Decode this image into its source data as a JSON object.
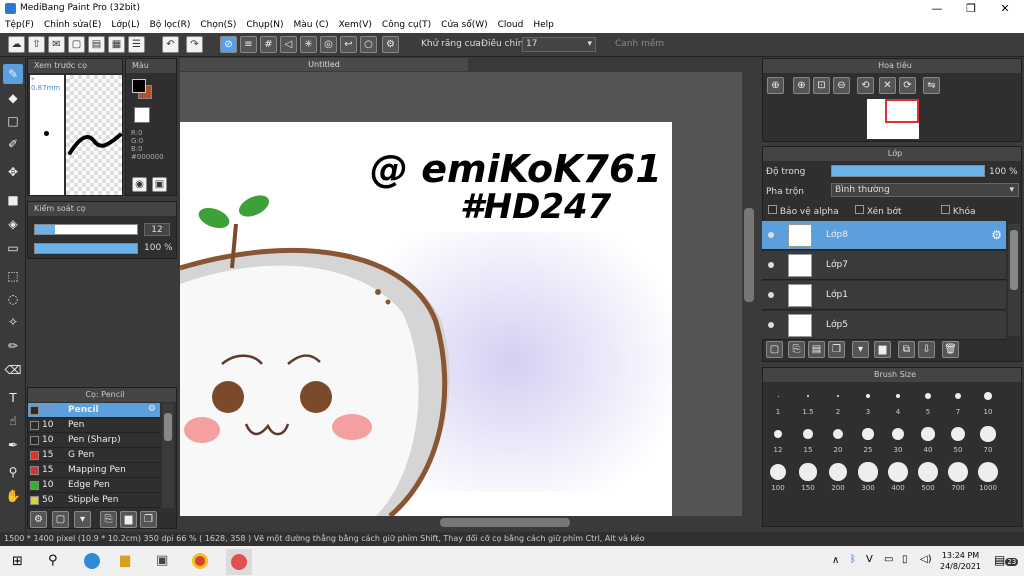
{
  "window": {
    "title": "MediBang Paint Pro (32bit)",
    "minimize": "—",
    "maximize": "❐",
    "close": "✕"
  },
  "menu": [
    "Tệp(F)",
    "Chỉnh sửa(E)",
    "Lớp(L)",
    "Bộ lọc(R)",
    "Chọn(S)",
    "Chụp(N)",
    "Màu (C)",
    "Xem(V)",
    "Công cụ(T)",
    "Cửa sổ(W)",
    "Cloud",
    "Help"
  ],
  "toolbar": {
    "antialias_label": "Khử răng cưa",
    "adjust_label": "Điều chỉnh",
    "adjust_value": "17",
    "snap_label": "Canh mềm"
  },
  "preview_panel": {
    "title": "Xem trước cọ",
    "size_label": "* 0.87mm"
  },
  "color_panel": {
    "title": "Màu",
    "r": "R:0",
    "g": "G:0",
    "b": "B:0",
    "hex": "#000000",
    "fg_color": "#000000",
    "bg_color": "#b05030"
  },
  "brush_control": {
    "title": "Kiểm soát cọ",
    "size_value": "12",
    "opacity_value": "100 %",
    "size_fraction": 0.2,
    "opacity_fraction": 1.0
  },
  "brush_list": {
    "title": "Cọ: Pencil",
    "items": [
      {
        "size": "12",
        "name": "Pencil",
        "color": "#2a2a2a",
        "selected": true
      },
      {
        "size": "10",
        "name": "Pen",
        "color": "#2a2a2a"
      },
      {
        "size": "10",
        "name": "Pen (Sharp)",
        "color": "#2a2a2a"
      },
      {
        "size": "15",
        "name": "G Pen",
        "color": "#e03030"
      },
      {
        "size": "15",
        "name": "Mapping Pen",
        "color": "#e03030"
      },
      {
        "size": "10",
        "name": "Edge Pen",
        "color": "#30b030"
      },
      {
        "size": "50",
        "name": "Stipple Pen",
        "color": "#e0d030"
      }
    ]
  },
  "document": {
    "tab": "Untitled"
  },
  "canvas_text": {
    "line1": "@ emiKoK761",
    "line2": "#HD247"
  },
  "navigator": {
    "title": "Hoa tiêu"
  },
  "layer_panel": {
    "title": "Lớp",
    "opacity_label": "Độ trong",
    "opacity_value": "100 %",
    "opacity_fraction": 1.0,
    "blend_label": "Pha trộn",
    "blend_value": "Bình thường",
    "protect_alpha": "Bảo vệ alpha",
    "clip": "Xén bớt",
    "lock": "Khóa",
    "layers": [
      {
        "name": "Lớp8",
        "selected": true
      },
      {
        "name": "Lớp7"
      },
      {
        "name": "Lớp1"
      },
      {
        "name": "Lớp5"
      }
    ]
  },
  "brush_size_panel": {
    "title": "Brush Size",
    "sizes": [
      "1",
      "1.5",
      "2",
      "3",
      "4",
      "5",
      "7",
      "10",
      "12",
      "15",
      "20",
      "25",
      "30",
      "40",
      "50",
      "70",
      "100",
      "150",
      "200",
      "300",
      "400",
      "500",
      "700",
      "1000"
    ]
  },
  "status_bar": {
    "text": "1500 * 1400 pixel   (10.9 * 10.2cm)   350 dpi    66 %   ( 1628, 358 )   Vẽ một đường thẳng bằng cách giữ phím Shift, Thay đổi cỡ cọ bằng cách giữ phím Ctrl, Alt và kéo"
  },
  "taskbar": {
    "time": "13:24 PM",
    "date": "24/8/2021",
    "notif": "23"
  }
}
